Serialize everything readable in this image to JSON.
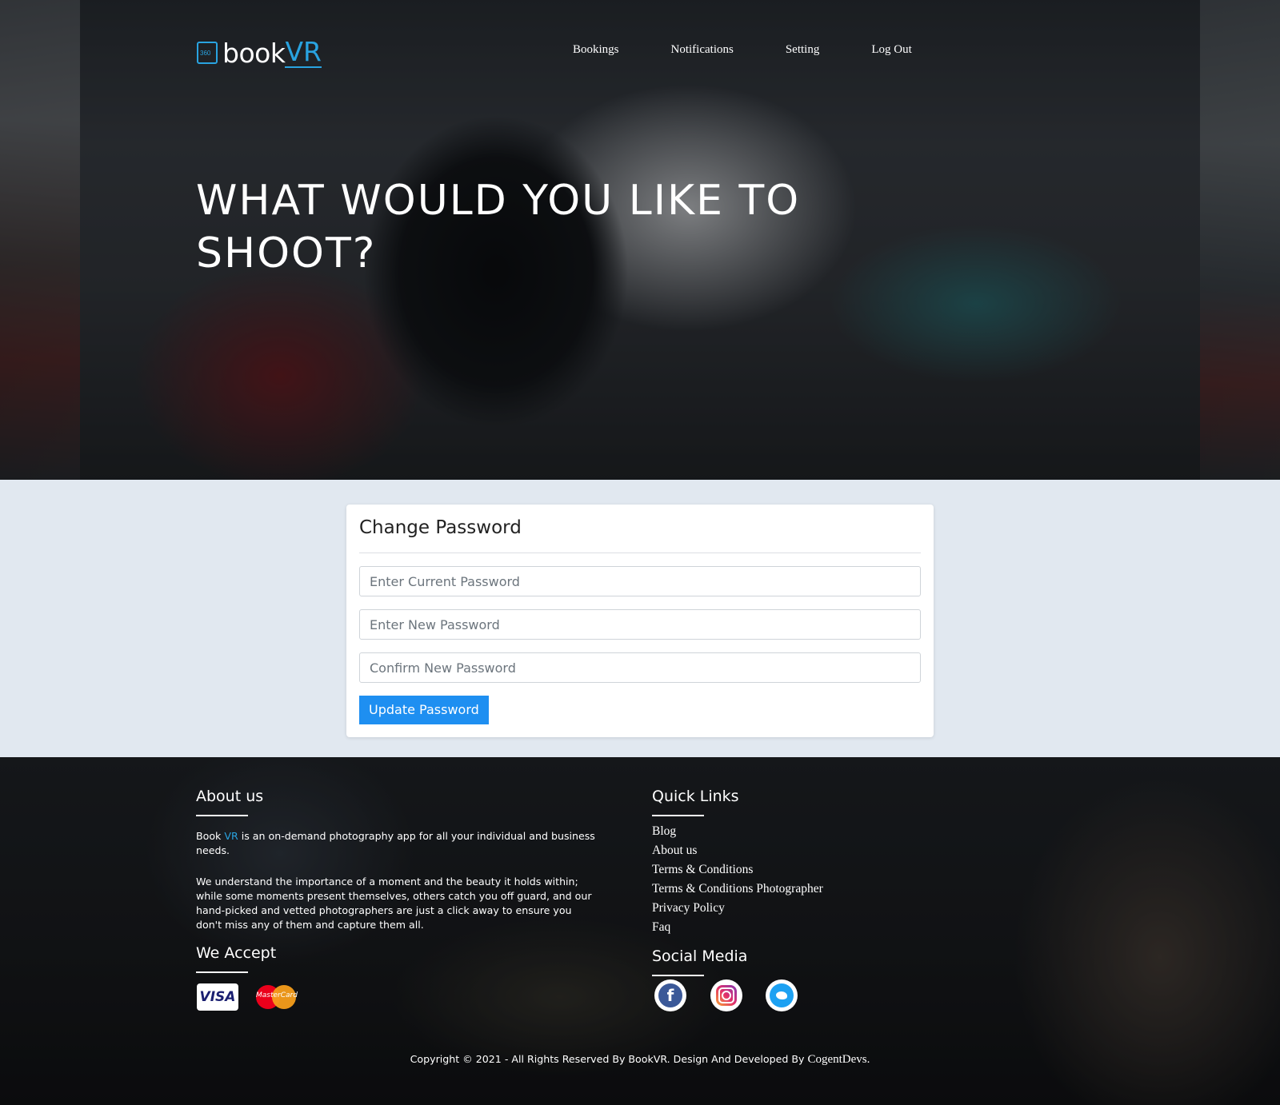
{
  "brand": {
    "name_main": "book",
    "name_accent": "VR",
    "accent_color": "#29a3e0"
  },
  "nav": {
    "items": [
      {
        "label": "Bookings"
      },
      {
        "label": "Notifications"
      },
      {
        "label": "Setting"
      },
      {
        "label": "Log Out"
      }
    ]
  },
  "hero": {
    "title_line1": "WHAT WOULD YOU LIKE TO",
    "title_line2": "SHOOT?"
  },
  "change_password": {
    "title": "Change Password",
    "current_placeholder": "Enter Current Password",
    "new_placeholder": "Enter New Password",
    "confirm_placeholder": "Confirm New Password",
    "submit_label": "Update Password",
    "button_color": "#1e8ff1"
  },
  "footer": {
    "about": {
      "title": "About us",
      "p1_prefix": "Book ",
      "p1_accent": "VR",
      "p1_suffix": " is an on-demand photography app for all your individual and business needs.",
      "p2": "We understand the importance of a moment and the beauty it holds within; while some moments present themselves, others catch you off guard, and our hand-picked and vetted photographers are just a click away to ensure you don't miss any of them and capture them all."
    },
    "we_accept": {
      "title": "We Accept",
      "cards": [
        {
          "name": "VISA"
        },
        {
          "name": "MasterCard"
        }
      ]
    },
    "quick_links": {
      "title": "Quick Links",
      "items": [
        {
          "label": "Blog"
        },
        {
          "label": "About us"
        },
        {
          "label": "Terms & Conditions"
        },
        {
          "label": "Terms & Conditions Photographer"
        },
        {
          "label": "Privacy Policy"
        },
        {
          "label": "Faq"
        }
      ]
    },
    "social": {
      "title": "Social Media",
      "items": [
        {
          "icon": "facebook-icon",
          "glyph": "f"
        },
        {
          "icon": "instagram-icon"
        },
        {
          "icon": "twitter-icon"
        }
      ]
    },
    "copyright_prefix": "Copyright © 2021 - All Rights Reserved By BookVR. Design And Developed By ",
    "copyright_company": "CogentDevs."
  }
}
